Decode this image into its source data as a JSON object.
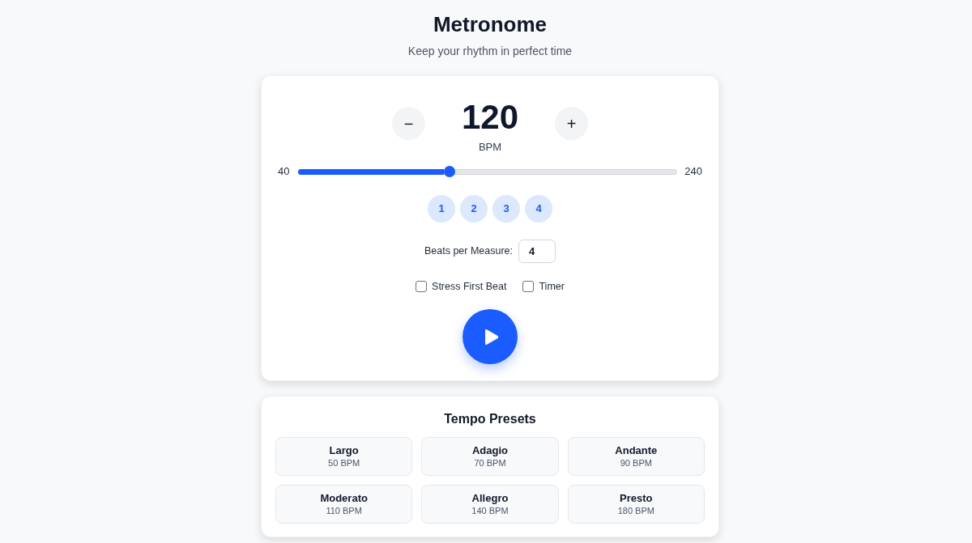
{
  "header": {
    "title": "Metronome",
    "subtitle": "Keep your rhythm in perfect time"
  },
  "tempo": {
    "decrease_label": "−",
    "value": "120",
    "unit": "BPM",
    "increase_label": "+"
  },
  "slider": {
    "min_label": "40",
    "max_label": "240",
    "level": 0.4
  },
  "beats": [
    {
      "label": "1",
      "active": false
    },
    {
      "label": "2",
      "active": false
    },
    {
      "label": "3",
      "active": false
    },
    {
      "label": "4",
      "active": false
    }
  ],
  "beats_per_measure": {
    "label": "Beats per Measure:",
    "value": "4"
  },
  "options": [
    {
      "label": "Stress First Beat",
      "checked": false
    },
    {
      "label": "Timer",
      "checked": false
    }
  ],
  "play_button": {
    "playing": false
  },
  "presets": {
    "title": "Tempo Presets",
    "items": [
      {
        "name": "Largo",
        "tempo": "50 BPM"
      },
      {
        "name": "Adagio",
        "tempo": "70 BPM"
      },
      {
        "name": "Andante",
        "tempo": "90 BPM"
      },
      {
        "name": "Moderato",
        "tempo": "110 BPM"
      },
      {
        "name": "Allegro",
        "tempo": "140 BPM"
      },
      {
        "name": "Presto",
        "tempo": "180 BPM"
      }
    ]
  }
}
